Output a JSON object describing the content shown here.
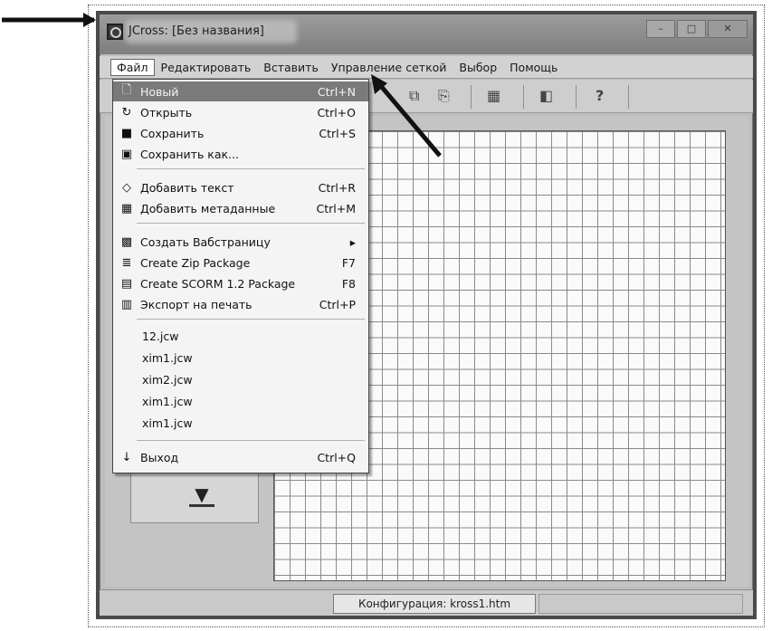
{
  "window": {
    "title": "JCross: [Без названия]",
    "controls": [
      "–",
      "□",
      "✕"
    ]
  },
  "menubar": {
    "items": [
      {
        "label": "Файл"
      },
      {
        "label": "Редактировать"
      },
      {
        "label": "Вставить"
      },
      {
        "label": "Управление сеткой"
      },
      {
        "label": "Выбор"
      },
      {
        "label": "Помощь"
      }
    ]
  },
  "toolbar": {
    "help_label": "?"
  },
  "file_menu": {
    "items": [
      {
        "label": "Новый",
        "shortcut": "Ctrl+N",
        "icon": "new-file-icon",
        "glyph": "🗋"
      },
      {
        "label": "Открыть",
        "shortcut": "Ctrl+O",
        "icon": "open-icon",
        "glyph": "↻"
      },
      {
        "label": "Сохранить",
        "shortcut": "Ctrl+S",
        "icon": "save-icon",
        "glyph": "■"
      },
      {
        "label": "Сохранить как...",
        "shortcut": "",
        "icon": "save-as-icon",
        "glyph": "▣"
      },
      {
        "label": "Добавить текст",
        "shortcut": "Ctrl+R",
        "icon": "add-text-icon",
        "glyph": "◇"
      },
      {
        "label": "Добавить метаданные",
        "shortcut": "Ctrl+M",
        "icon": "metadata-icon",
        "glyph": "▦"
      },
      {
        "label": "Создать Вабстраницу",
        "shortcut": "▸",
        "icon": "webpage-icon",
        "glyph": "▩"
      },
      {
        "label": "Create Zip Package",
        "shortcut": "F7",
        "icon": "zip-icon",
        "glyph": "≣"
      },
      {
        "label": "Create SCORM 1.2 Package",
        "shortcut": "F8",
        "icon": "scorm-icon",
        "glyph": "▤"
      },
      {
        "label": "Экспорт на печать",
        "shortcut": "Ctrl+P",
        "icon": "print-icon",
        "glyph": "▥"
      },
      {
        "label": "Выход",
        "shortcut": "Ctrl+Q",
        "icon": "exit-icon",
        "glyph": "↓"
      }
    ],
    "recent_files": [
      "12.jcw",
      "xim1.jcw",
      "xim2.jcw",
      "xim1.jcw",
      "xim1.jcw"
    ]
  },
  "status": {
    "config": "Конфигурация: kross1.htm"
  }
}
